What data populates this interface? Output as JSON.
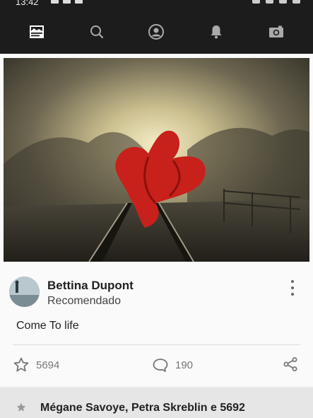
{
  "status_bar": {
    "time": "13:42"
  },
  "nav": {
    "items": [
      {
        "name": "feed",
        "icon": "feed-icon",
        "active": true
      },
      {
        "name": "search",
        "icon": "search-icon"
      },
      {
        "name": "profile",
        "icon": "profile-icon"
      },
      {
        "name": "notifications",
        "icon": "bell-icon"
      },
      {
        "name": "camera",
        "icon": "camera-icon"
      }
    ]
  },
  "post": {
    "photo_alt": "Person in red flowing dress on foggy railway tracks",
    "author": {
      "name": "Bettina Dupont",
      "subtitle": "Recomendado"
    },
    "caption": "Come To life",
    "likes": "5694",
    "comments": "190"
  },
  "likers": {
    "text": "Mégane Savoye, Petra Skreblin e 5692"
  },
  "colors": {
    "nav_bg": "#1c1c1c",
    "icon_grey": "#777777",
    "likers_bg": "#e6e6e6"
  }
}
